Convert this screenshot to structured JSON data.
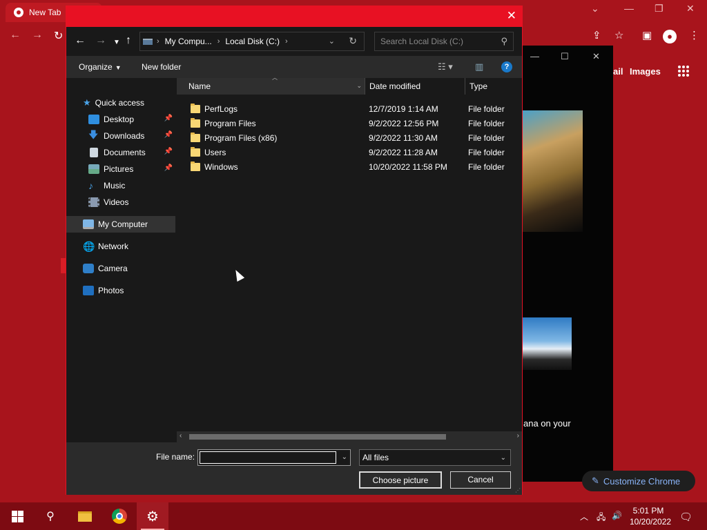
{
  "chrome": {
    "tab_title": "New Tab",
    "gmail_label": "ail",
    "images_label": "Images",
    "cortana_text": "ana on your",
    "customize_label": "Customize Chrome"
  },
  "dialog": {
    "close_glyph": "✕",
    "path": [
      "My Compu...",
      "Local Disk (C:)"
    ],
    "search_placeholder": "Search Local Disk (C:)",
    "organize_label": "Organize",
    "new_folder_label": "New folder",
    "nav": {
      "quick_access": "Quick access",
      "items": [
        "Desktop",
        "Downloads",
        "Documents",
        "Pictures",
        "Music",
        "Videos"
      ],
      "my_computer": "My Computer",
      "network": "Network",
      "camera": "Camera",
      "photos": "Photos"
    },
    "columns": {
      "name": "Name",
      "date": "Date modified",
      "type": "Type"
    },
    "files": [
      {
        "name": "PerfLogs",
        "date": "12/7/2019 1:14 AM",
        "type": "File folder"
      },
      {
        "name": "Program Files",
        "date": "9/2/2022 12:56 PM",
        "type": "File folder"
      },
      {
        "name": "Program Files (x86)",
        "date": "9/2/2022 11:30 AM",
        "type": "File folder"
      },
      {
        "name": "Users",
        "date": "9/2/2022 11:28 AM",
        "type": "File folder"
      },
      {
        "name": "Windows",
        "date": "10/20/2022 11:58 PM",
        "type": "File folder"
      }
    ],
    "file_name_label": "File name:",
    "file_name_value": "",
    "file_type": "All files",
    "choose_label": "Choose picture",
    "cancel_label": "Cancel"
  },
  "taskbar": {
    "time": "5:01 PM",
    "date": "10/20/2022"
  },
  "colors": {
    "accent_red": "#e81123",
    "desktop_red": "#a8141c",
    "dialog_bg": "#191919"
  }
}
